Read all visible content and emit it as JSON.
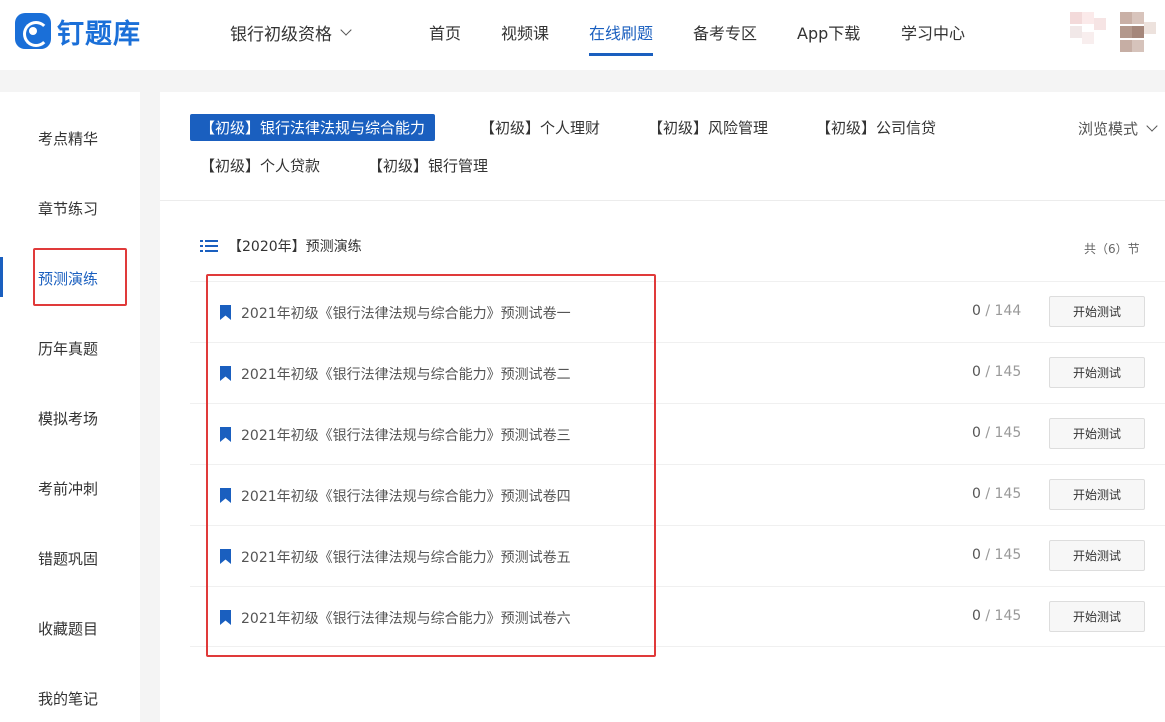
{
  "header": {
    "logo_text": "钉题库",
    "exam_select": "银行初级资格",
    "nav": [
      {
        "label": "首页",
        "active": false
      },
      {
        "label": "视频课",
        "active": false
      },
      {
        "label": "在线刷题",
        "active": true
      },
      {
        "label": "备考专区",
        "active": false
      },
      {
        "label": "App下载",
        "active": false
      },
      {
        "label": "学习中心",
        "active": false
      }
    ]
  },
  "sidebar": {
    "items": [
      {
        "label": "考点精华",
        "active": false
      },
      {
        "label": "章节练习",
        "active": false
      },
      {
        "label": "预测演练",
        "active": true
      },
      {
        "label": "历年真题",
        "active": false
      },
      {
        "label": "模拟考场",
        "active": false
      },
      {
        "label": "考前冲刺",
        "active": false
      },
      {
        "label": "错题巩固",
        "active": false
      },
      {
        "label": "收藏题目",
        "active": false
      },
      {
        "label": "我的笔记",
        "active": false
      }
    ]
  },
  "subjects": [
    {
      "label": "【初级】银行法律法规与综合能力",
      "active": true
    },
    {
      "label": "【初级】个人理财",
      "active": false
    },
    {
      "label": "【初级】风险管理",
      "active": false
    },
    {
      "label": "【初级】公司信贷",
      "active": false
    },
    {
      "label": "【初级】个人贷款",
      "active": false
    },
    {
      "label": "【初级】银行管理",
      "active": false
    }
  ],
  "browse_mode": "浏览模式",
  "section": {
    "title": "【2020年】预测演练",
    "count": "共（6）节"
  },
  "papers": [
    {
      "title": "2021年初级《银行法律法规与综合能力》预测试卷一",
      "done": "0",
      "total": "/ 144",
      "button": "开始测试"
    },
    {
      "title": "2021年初级《银行法律法规与综合能力》预测试卷二",
      "done": "0",
      "total": "/ 145",
      "button": "开始测试"
    },
    {
      "title": "2021年初级《银行法律法规与综合能力》预测试卷三",
      "done": "0",
      "total": "/ 145",
      "button": "开始测试"
    },
    {
      "title": "2021年初级《银行法律法规与综合能力》预测试卷四",
      "done": "0",
      "total": "/ 145",
      "button": "开始测试"
    },
    {
      "title": "2021年初级《银行法律法规与综合能力》预测试卷五",
      "done": "0",
      "total": "/ 145",
      "button": "开始测试"
    },
    {
      "title": "2021年初级《银行法律法规与综合能力》预测试卷六",
      "done": "0",
      "total": "/ 145",
      "button": "开始测试"
    }
  ],
  "colors": {
    "accent": "#1a5fbf",
    "highlight_box": "#e03a3a"
  }
}
